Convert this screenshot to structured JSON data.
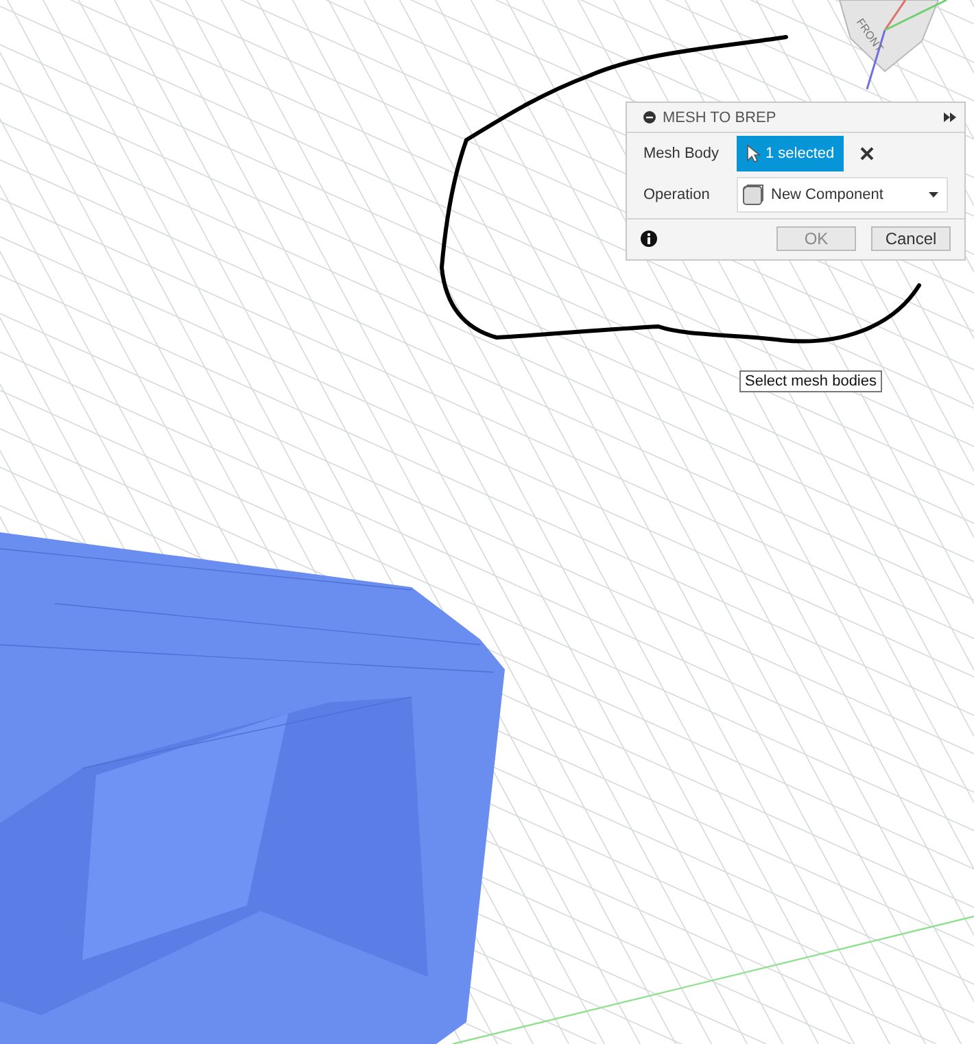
{
  "viewport": {
    "view_cube": {
      "face_label": "FRONT"
    }
  },
  "dialog": {
    "title": "MESH TO BREP",
    "rows": [
      {
        "kind": "selection",
        "label": "Mesh Body",
        "value": "1 selected",
        "active": true
      },
      {
        "kind": "dropdown",
        "label": "Operation",
        "value": "New Component"
      }
    ],
    "buttons": [
      {
        "label": "OK",
        "disabled": true
      },
      {
        "label": "Cancel",
        "disabled": false
      }
    ]
  },
  "tooltip": "Select mesh bodies"
}
